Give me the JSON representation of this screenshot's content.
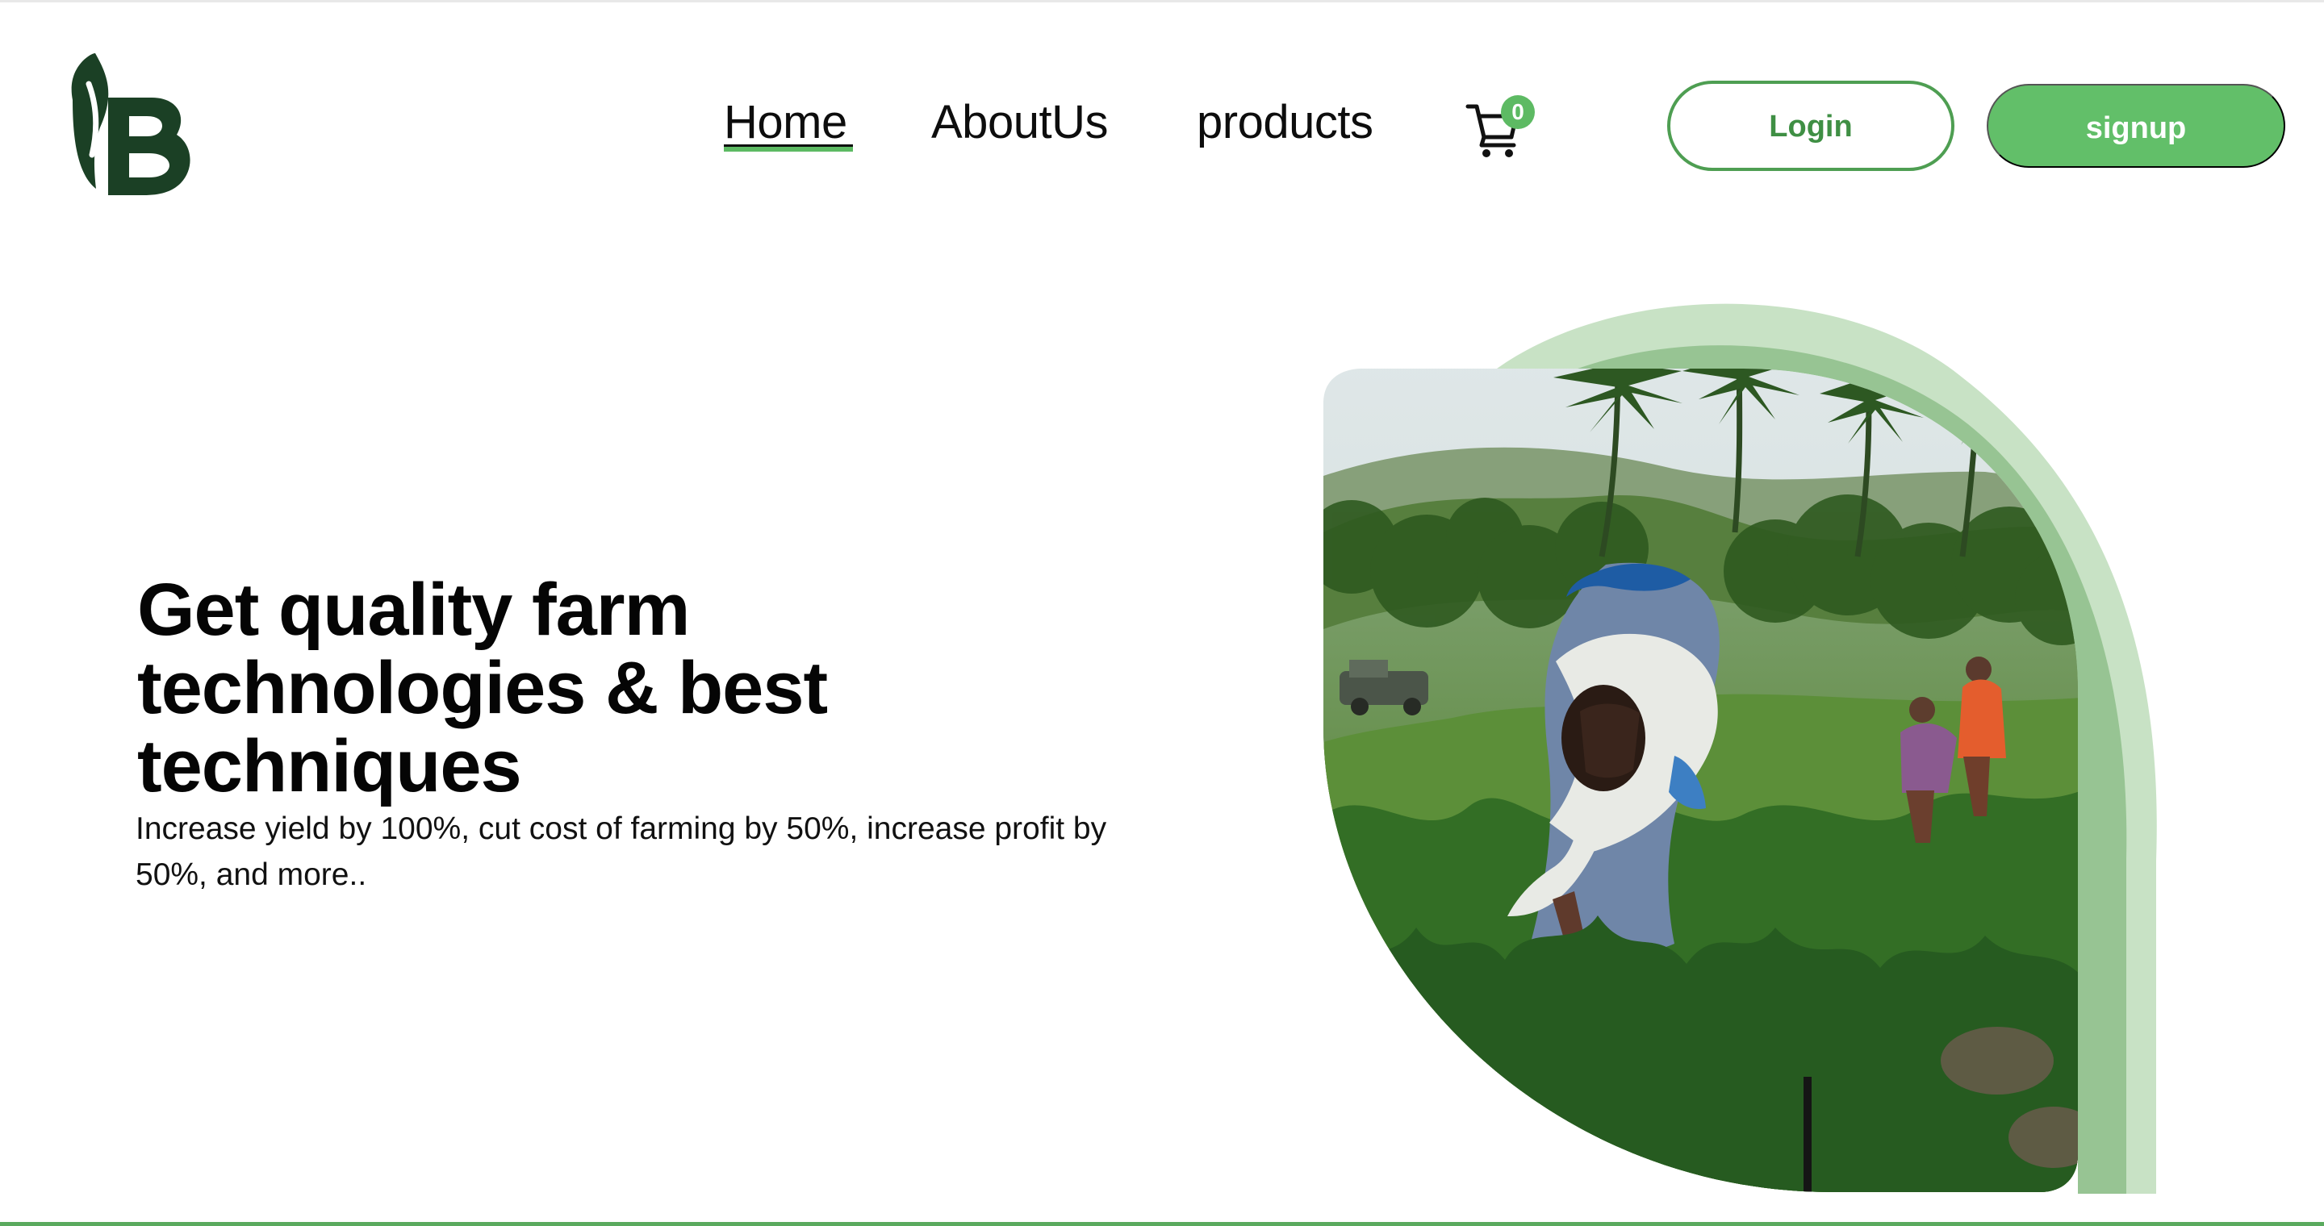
{
  "header": {
    "logo_name": "leaf-b-logo",
    "nav": [
      {
        "label": "Home",
        "active": true
      },
      {
        "label": "AboutUs",
        "active": false
      },
      {
        "label": "products",
        "active": false
      }
    ],
    "cart": {
      "icon": "cart-icon",
      "count": "0"
    },
    "buttons": {
      "login": "Login",
      "signup": "signup"
    }
  },
  "hero": {
    "title": "Get quality farm technologies & best techniques",
    "subtitle": "Increase yield by 100%, cut cost of farming by 50%, increase profit by 50%, and more.."
  },
  "colors": {
    "accent": "#5dba63",
    "accent_dark": "#1f4a2b",
    "arc_light": "#c8e2c5",
    "arc_mid": "#97c493"
  }
}
